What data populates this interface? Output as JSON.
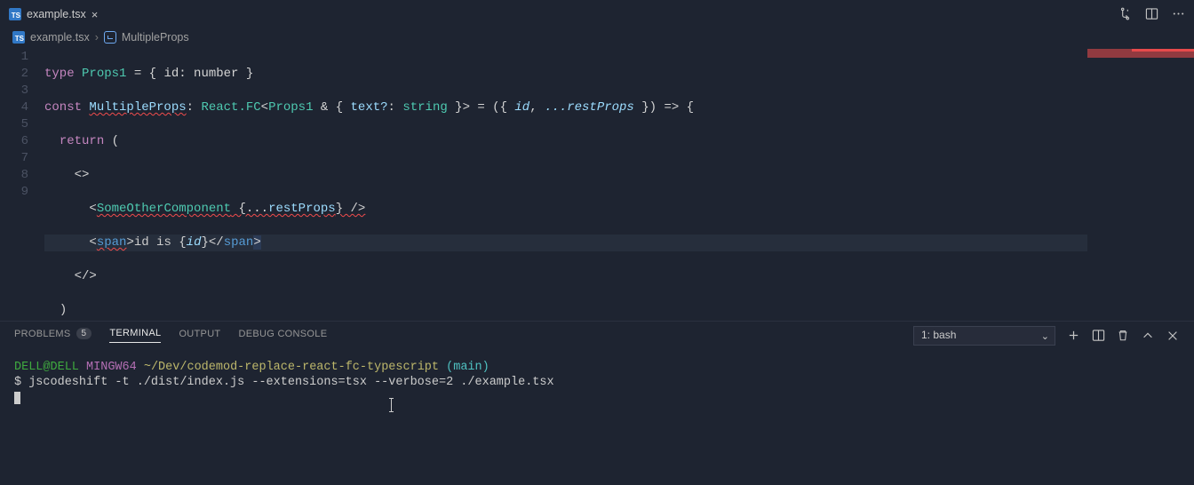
{
  "tabs": [
    {
      "label": "example.tsx",
      "icon": "TS"
    }
  ],
  "breadcrumb": {
    "file_icon": "TS",
    "file": "example.tsx",
    "symbol": "MultipleProps"
  },
  "code": {
    "lines": [
      "1",
      "2",
      "3",
      "4",
      "5",
      "6",
      "7",
      "8",
      "9"
    ],
    "l1": {
      "kw": "type",
      "name": "Props1",
      "rest": " = { id: number }"
    },
    "l2": {
      "kw": "const",
      "name": "MultipleProps",
      "colon": ": ",
      "fc": "React.FC",
      "gen_open": "<",
      "p1": "Props1",
      "amp": " & { ",
      "textq": "text?",
      "colon2": ": ",
      "str": "string",
      "gen_close": " }> = ({ ",
      "id": "id",
      "comma": ", ",
      "rest": "...restProps",
      "arrow": " }) => {"
    },
    "l3": {
      "kw": "return",
      "paren": " ("
    },
    "l4": {
      "frag": "<>"
    },
    "l5": {
      "open": "<",
      "comp": "SomeOtherComponent",
      "sp": " {...",
      "rest": "restProps",
      "close": "} />"
    },
    "l6": {
      "open": "<",
      "tag": "span",
      "gt": ">",
      "text": "id is ",
      "braceo": "{",
      "id": "id",
      "bracec": "}",
      "openc": "</",
      "tag2": "span",
      "gt2": ">"
    },
    "l7": {
      "frag": "</>"
    },
    "l8": {
      "paren": ")"
    },
    "l9": {
      "brace": "}"
    }
  },
  "panel": {
    "tabs": {
      "problems": "PROBLEMS",
      "problems_count": "5",
      "terminal": "TERMINAL",
      "output": "OUTPUT",
      "debug": "DEBUG CONSOLE"
    },
    "terminal_select": "1: bash"
  },
  "terminal": {
    "line1": {
      "user": "DELL@DELL",
      "mingw": "MINGW64",
      "path": "~/Dev/codemod-replace-react-fc-typescript",
      "branch": "(main)"
    },
    "line2": {
      "prompt": "$ ",
      "cmd": "jscodeshift -t ./dist/index.js  --extensions=tsx --verbose=2 ./example.tsx"
    }
  }
}
